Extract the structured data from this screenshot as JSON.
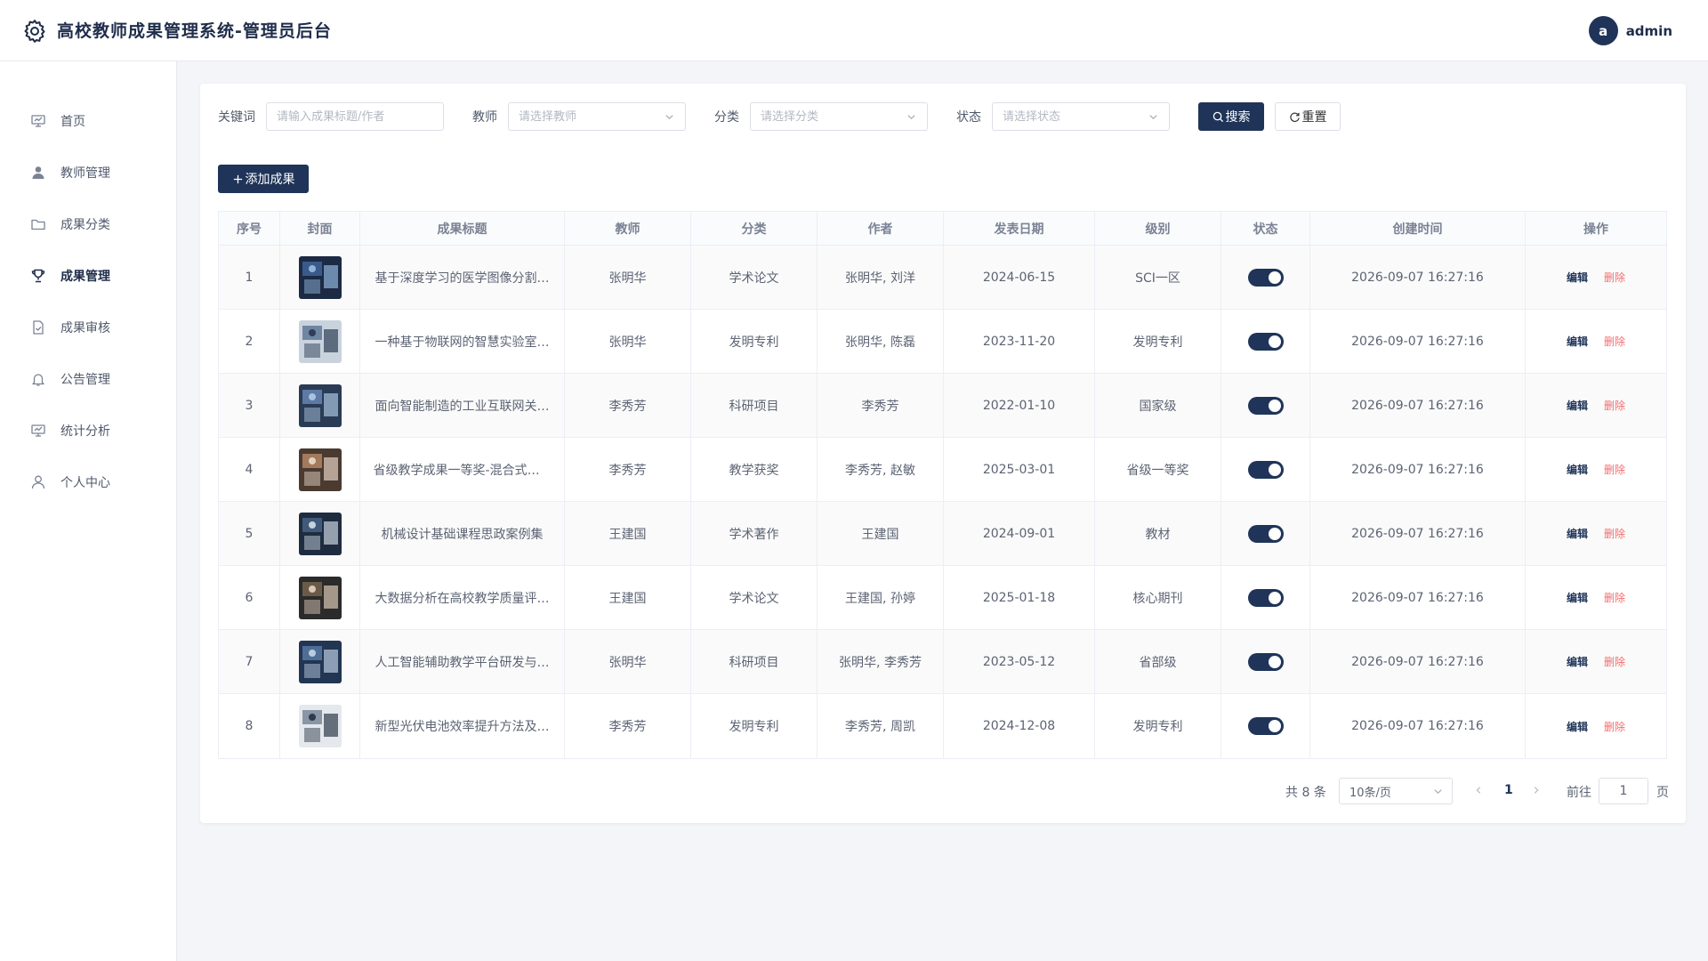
{
  "header": {
    "title": "高校教师成果管理系统-管理员后台",
    "avatar_letter": "a",
    "username": "admin"
  },
  "sidebar": {
    "items": [
      {
        "label": "首页",
        "icon": "presentation-icon",
        "active": false
      },
      {
        "label": "教师管理",
        "icon": "user-solid-icon",
        "active": false
      },
      {
        "label": "成果分类",
        "icon": "folder-icon",
        "active": false
      },
      {
        "label": "成果管理",
        "icon": "trophy-icon",
        "active": true
      },
      {
        "label": "成果审核",
        "icon": "document-check-icon",
        "active": false
      },
      {
        "label": "公告管理",
        "icon": "bell-icon",
        "active": false
      },
      {
        "label": "统计分析",
        "icon": "chart-board-icon",
        "active": false
      },
      {
        "label": "个人中心",
        "icon": "user-outline-icon",
        "active": false
      }
    ]
  },
  "filters": {
    "keyword_label": "关键词",
    "keyword_placeholder": "请输入成果标题/作者",
    "teacher_label": "教师",
    "teacher_placeholder": "请选择教师",
    "category_label": "分类",
    "category_placeholder": "请选择分类",
    "status_label": "状态",
    "status_placeholder": "请选择状态",
    "search_label": "搜索",
    "reset_label": "重置"
  },
  "toolbar": {
    "add_label": "添加成果"
  },
  "table": {
    "columns": [
      "序号",
      "封面",
      "成果标题",
      "教师",
      "分类",
      "作者",
      "发表日期",
      "级别",
      "状态",
      "创建时间",
      "操作"
    ],
    "edit_label": "编辑",
    "delete_label": "删除",
    "rows": [
      {
        "no": "1",
        "title": "基于深度学习的医学图像分割…",
        "teacher": "张明华",
        "category": "学术论文",
        "authors": "张明华, 刘洋",
        "date": "2024-06-15",
        "level": "SCI一区",
        "status_on": true,
        "created": "2026-09-07 16:27:16"
      },
      {
        "no": "2",
        "title": "一种基于物联网的智慧实验室…",
        "teacher": "张明华",
        "category": "发明专利",
        "authors": "张明华, 陈磊",
        "date": "2023-11-20",
        "level": "发明专利",
        "status_on": true,
        "created": "2026-09-07 16:27:16"
      },
      {
        "no": "3",
        "title": "面向智能制造的工业互联网关…",
        "teacher": "李秀芳",
        "category": "科研项目",
        "authors": "李秀芳",
        "date": "2022-01-10",
        "level": "国家级",
        "status_on": true,
        "created": "2026-09-07 16:27:16"
      },
      {
        "no": "4",
        "title": "省级教学成果一等奖-混合式教…",
        "teacher": "李秀芳",
        "category": "教学获奖",
        "authors": "李秀芳, 赵敏",
        "date": "2025-03-01",
        "level": "省级一等奖",
        "status_on": true,
        "created": "2026-09-07 16:27:16"
      },
      {
        "no": "5",
        "title": "机械设计基础课程思政案例集",
        "teacher": "王建国",
        "category": "学术著作",
        "authors": "王建国",
        "date": "2024-09-01",
        "level": "教材",
        "status_on": true,
        "created": "2026-09-07 16:27:16"
      },
      {
        "no": "6",
        "title": "大数据分析在高校教学质量评…",
        "teacher": "王建国",
        "category": "学术论文",
        "authors": "王建国, 孙婷",
        "date": "2025-01-18",
        "level": "核心期刊",
        "status_on": true,
        "created": "2026-09-07 16:27:16"
      },
      {
        "no": "7",
        "title": "人工智能辅助教学平台研发与…",
        "teacher": "张明华",
        "category": "科研项目",
        "authors": "张明华, 李秀芳",
        "date": "2023-05-12",
        "level": "省部级",
        "status_on": true,
        "created": "2026-09-07 16:27:16"
      },
      {
        "no": "8",
        "title": "新型光伏电池效率提升方法及…",
        "teacher": "李秀芳",
        "category": "发明专利",
        "authors": "李秀芳, 周凯",
        "date": "2024-12-08",
        "level": "发明专利",
        "status_on": true,
        "created": "2026-09-07 16:27:16"
      }
    ]
  },
  "pagination": {
    "total_text": "共 8 条",
    "page_size": "10条/页",
    "current_page": "1",
    "goto_label": "前往",
    "goto_value": "1",
    "page_suffix": "页"
  },
  "colors": {
    "primary": "#1f3458",
    "danger": "#f56c6c"
  }
}
